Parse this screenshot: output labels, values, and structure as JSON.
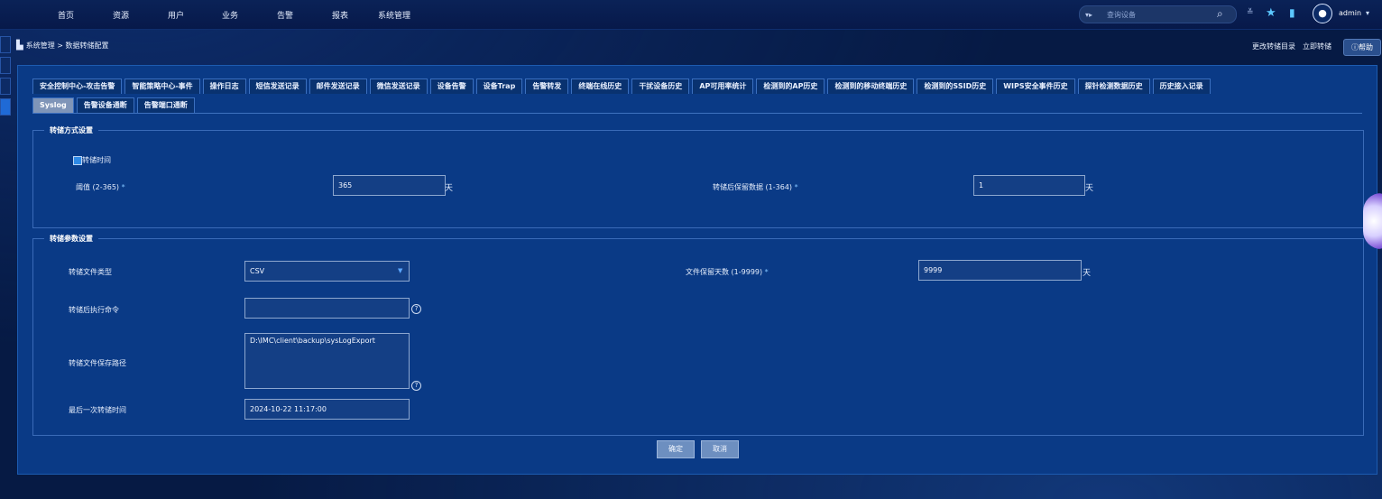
{
  "nav": {
    "items": [
      "首页",
      "资源",
      "用户",
      "业务",
      "告警",
      "报表",
      "系统管理"
    ],
    "search_tag": "▾▸",
    "search_placeholder": "查询设备",
    "user": "admin"
  },
  "breadcrumb": "系统管理 > 数据转储配置",
  "actions": {
    "change_dir": "更改转储目录",
    "dump_now": "立即转储",
    "help": "帮助"
  },
  "tabs_row1": [
    "安全控制中心-攻击告警",
    "智能策略中心-事件",
    "操作日志",
    "短信发送记录",
    "邮件发送记录",
    "微信发送记录",
    "设备告警",
    "设备Trap",
    "告警转发",
    "终端在线历史",
    "干扰设备历史",
    "AP可用率统计",
    "检测到的AP历史",
    "检测到的移动终端历史",
    "检测到的SSID历史",
    "WIPS安全事件历史",
    "探针检测数据历史",
    "历史接入记录"
  ],
  "tabs_row2": [
    "Syslog",
    "告警设备通断",
    "告警端口通断"
  ],
  "active_tab": "Syslog",
  "dump_mode": {
    "legend": "转储方式设置",
    "checkbox_label": "转储时间",
    "threshold_label": "阈值 (2-365)",
    "threshold_value": "365",
    "threshold_unit": "天",
    "keep_label": "转储后保留数据 (1-364)",
    "keep_value": "1",
    "keep_unit": "天",
    "required_mark": "*"
  },
  "dump_params": {
    "legend": "转储参数设置",
    "file_type_label": "转储文件类型",
    "file_type_value": "CSV",
    "file_keep_label": "文件保留天数 (1-9999)",
    "file_keep_value": "9999",
    "file_keep_unit": "天",
    "post_cmd_label": "转储后执行命令",
    "post_cmd_value": "",
    "path_label": "转储文件保存路径",
    "path_value": "D:\\IMC\\client\\backup\\sysLogExport",
    "last_time_label": "最后一次转储时间",
    "last_time_value": "2024-10-22 11:17:00",
    "required_mark": "*",
    "help_mark": "?"
  },
  "buttons": {
    "ok": "确定",
    "cancel": "取消"
  }
}
